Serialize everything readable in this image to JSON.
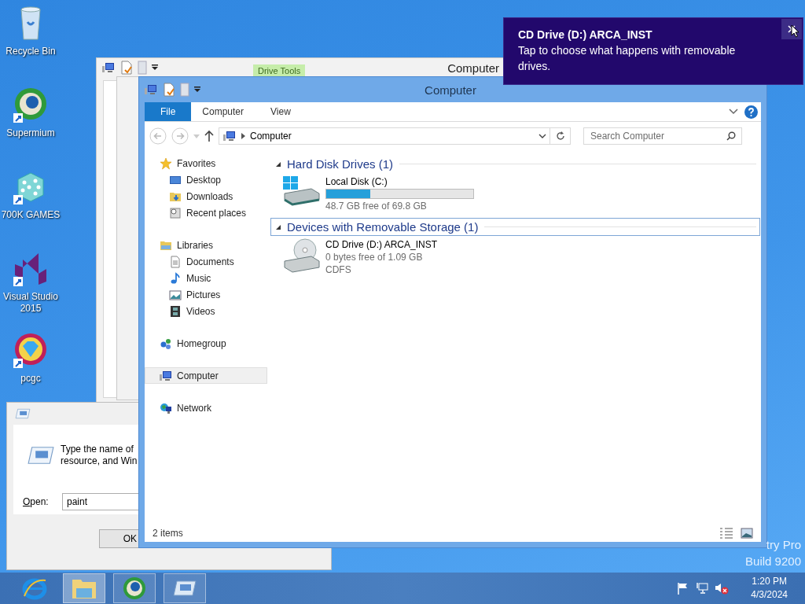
{
  "desktop_icons": [
    {
      "label": "Recycle Bin",
      "kind": "bin",
      "shortcut": false
    },
    {
      "label": "Supermium",
      "kind": "browser",
      "shortcut": true
    },
    {
      "label": "700K GAMES",
      "kind": "dice",
      "shortcut": true
    },
    {
      "label": "Visual Studio 2015",
      "kind": "vs",
      "shortcut": true
    },
    {
      "label": "pcgc",
      "kind": "gem",
      "shortcut": true
    }
  ],
  "back_window": {
    "title": "Computer",
    "context_tab": "Drive Tools"
  },
  "run_dialog": {
    "lines": [
      "Type the name of",
      "resource, and Win"
    ],
    "open_label": "Open:",
    "value": "paint",
    "ok_button": "OK"
  },
  "explorer": {
    "title": "Computer",
    "ribbon_tabs": [
      {
        "label": "File",
        "selected": true
      },
      {
        "label": "Computer",
        "selected": false
      },
      {
        "label": "View",
        "selected": false
      }
    ],
    "address": "Computer",
    "search": {
      "placeholder": "Search Computer"
    },
    "nav": [
      {
        "label": "Favorites",
        "kind": "star",
        "selected": false,
        "children": [
          {
            "label": "Desktop",
            "kind": "desktop",
            "selected": false
          },
          {
            "label": "Downloads",
            "kind": "downloads",
            "selected": false
          },
          {
            "label": "Recent places",
            "kind": "recent",
            "selected": false
          }
        ]
      },
      {
        "label": "Libraries",
        "kind": "library",
        "selected": false,
        "children": [
          {
            "label": "Documents",
            "kind": "document",
            "selected": false
          },
          {
            "label": "Music",
            "kind": "music",
            "selected": false
          },
          {
            "label": "Pictures",
            "kind": "pictures",
            "selected": false
          },
          {
            "label": "Videos",
            "kind": "videos",
            "selected": false
          }
        ]
      },
      {
        "label": "Homegroup",
        "kind": "homegroup",
        "selected": false
      },
      {
        "label": "Computer",
        "kind": "computer",
        "selected": true
      },
      {
        "label": "Network",
        "kind": "network",
        "selected": false
      }
    ],
    "groups": [
      {
        "title": "Hard Disk Drives (1)",
        "selected": false,
        "drives": [
          {
            "name": "Local Disk (C:)",
            "kind": "hdd",
            "level": 0.3,
            "details": [
              "48.7 GB free of 69.8 GB"
            ]
          }
        ]
      },
      {
        "title": "Devices with Removable Storage (1)",
        "selected": true,
        "drives": [
          {
            "name": "CD Drive (D:) ARCA_INST",
            "kind": "cd",
            "details": [
              "0 bytes free of 1.09 GB",
              "CDFS"
            ]
          }
        ]
      }
    ],
    "status": "2 items"
  },
  "toast": {
    "title": "CD Drive (D:) ARCA_INST",
    "message": "Tap to choose what happens with removable drives."
  },
  "desktop_text": [
    "try Pro",
    "Build 9200"
  ],
  "taskbar": {
    "apps": [
      {
        "kind": "ie",
        "open": false,
        "selected": false
      },
      {
        "kind": "explorer",
        "open": true,
        "selected": true
      },
      {
        "kind": "browser",
        "open": true,
        "selected": false
      },
      {
        "kind": "run",
        "open": true,
        "selected": false
      }
    ],
    "time": "1:20 PM",
    "date": "4/3/2024"
  }
}
